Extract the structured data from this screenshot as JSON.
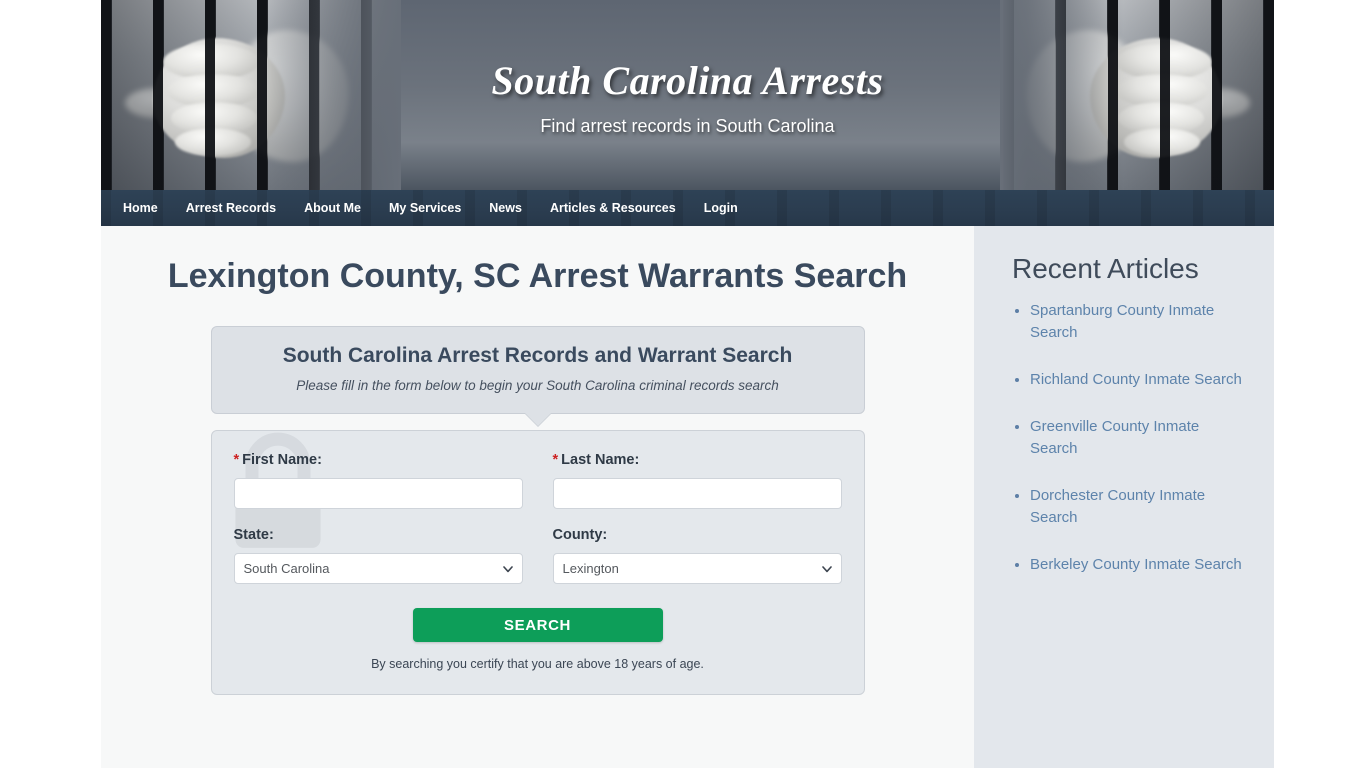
{
  "site": {
    "title": "South Carolina Arrests",
    "tagline": "Find arrest records in South Carolina"
  },
  "nav": {
    "items": [
      {
        "label": "Home"
      },
      {
        "label": "Arrest Records"
      },
      {
        "label": "About Me"
      },
      {
        "label": "My Services"
      },
      {
        "label": "News"
      },
      {
        "label": "Articles & Resources"
      },
      {
        "label": "Login"
      }
    ]
  },
  "main": {
    "page_title": "Lexington County, SC Arrest Warrants Search",
    "widget": {
      "heading": "South Carolina Arrest Records and Warrant Search",
      "subheading": "Please fill in the form below to begin your South Carolina criminal records search"
    },
    "form": {
      "first_name": {
        "label": "First Name:",
        "required_marker": "*",
        "value": "",
        "placeholder": ""
      },
      "last_name": {
        "label": "Last Name:",
        "required_marker": "*",
        "value": "",
        "placeholder": ""
      },
      "state": {
        "label": "State:",
        "value": "South Carolina",
        "options": [
          "South Carolina"
        ]
      },
      "county": {
        "label": "County:",
        "value": "Lexington",
        "options": [
          "Lexington"
        ]
      },
      "search_button": "SEARCH",
      "disclaimer": "By searching you certify that you are above 18 years of age."
    }
  },
  "sidebar": {
    "heading": "Recent Articles",
    "articles": [
      {
        "label": "Spartanburg County Inmate Search"
      },
      {
        "label": "Richland County Inmate Search"
      },
      {
        "label": "Greenville County Inmate Search"
      },
      {
        "label": "Dorchester County Inmate Search"
      },
      {
        "label": "Berkeley County Inmate Search"
      }
    ]
  },
  "colors": {
    "nav_bg": "#2b3d50",
    "heading": "#3a4a5e",
    "link": "#5d83ab",
    "button": "#0d9e59",
    "required": "#cc2222",
    "sidebar_bg": "#e3e7ec",
    "main_bg": "#f7f8f8"
  }
}
